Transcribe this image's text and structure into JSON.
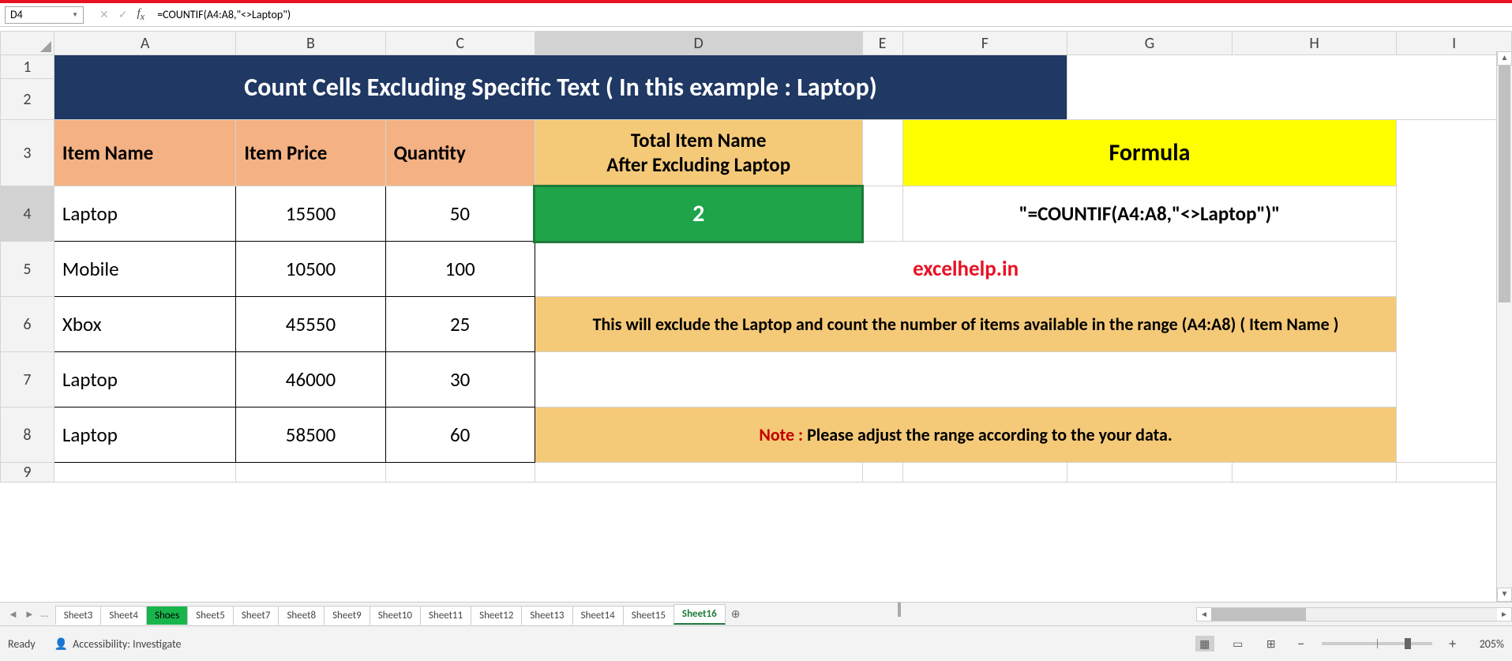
{
  "namebox": {
    "ref": "D4"
  },
  "formula_bar": {
    "value": "=COUNTIF(A4:A8,\"<>Laptop\")"
  },
  "columns": [
    "A",
    "B",
    "C",
    "D",
    "E",
    "F",
    "G",
    "H",
    "I"
  ],
  "rows": [
    "1",
    "2",
    "3",
    "4",
    "5",
    "6",
    "7",
    "8",
    "9"
  ],
  "selected_col": "D",
  "selected_row": "4",
  "title": "Count Cells Excluding Specific Text ( In this example : Laptop)",
  "headers": {
    "item_name": "Item Name",
    "item_price": "Item Price",
    "quantity": "Quantity",
    "total_after_exclude_line1": "Total Item Name",
    "total_after_exclude_line2": "After Excluding Laptop",
    "formula": "Formula"
  },
  "data_rows": [
    {
      "name": "Laptop",
      "price": "15500",
      "qty": "50"
    },
    {
      "name": "Mobile",
      "price": "10500",
      "qty": "100"
    },
    {
      "name": "Xbox",
      "price": "45550",
      "qty": "25"
    },
    {
      "name": "Laptop",
      "price": "46000",
      "qty": "30"
    },
    {
      "name": "Laptop",
      "price": "58500",
      "qty": "60"
    }
  ],
  "result_value": "2",
  "formula_display": "\"=COUNTIF(A4:A8,\"<>Laptop\")\"",
  "watermark": "excelhelp.in",
  "explain": "This will exclude the Laptop and count the number of items available in the range (A4:A8) ( Item Name )",
  "note_label": "Note :",
  "note_text": " Please adjust the range according to the your data.",
  "tabs": [
    "Sheet3",
    "Sheet4",
    "Shoes",
    "Sheet5",
    "Sheet7",
    "Sheet8",
    "Sheet9",
    "Sheet10",
    "Sheet11",
    "Sheet12",
    "Sheet13",
    "Sheet14",
    "Sheet15",
    "Sheet16"
  ],
  "active_tab": "Sheet16",
  "green_tab": "Shoes",
  "status": {
    "ready": "Ready",
    "acc": "Accessibility: Investigate",
    "zoom": "205%"
  },
  "chart_data": {
    "type": "table",
    "title": "Count Cells Excluding Specific Text",
    "columns": [
      "Item Name",
      "Item Price",
      "Quantity"
    ],
    "rows": [
      [
        "Laptop",
        15500,
        50
      ],
      [
        "Mobile",
        10500,
        100
      ],
      [
        "Xbox",
        45550,
        25
      ],
      [
        "Laptop",
        46000,
        30
      ],
      [
        "Laptop",
        58500,
        60
      ]
    ],
    "formula": "=COUNTIF(A4:A8,\"<>Laptop\")",
    "result": 2
  }
}
